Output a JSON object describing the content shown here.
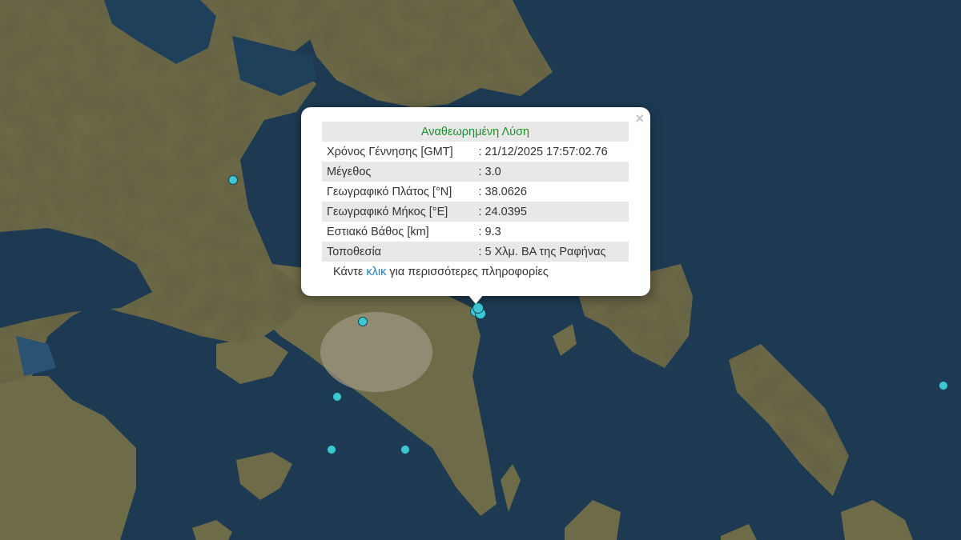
{
  "popup": {
    "title": "Αναθεωρημένη Λύση",
    "close": "×",
    "rows": [
      {
        "label": "Χρόνος Γέννησης [GMT]",
        "value": ": 21/12/2025 17:57:02.76"
      },
      {
        "label": "Μέγεθος",
        "value": ": 3.0"
      },
      {
        "label": "Γεωγραφικό Πλάτος [°N]",
        "value": ": 38.0626"
      },
      {
        "label": "Γεωγραφικό Μήκος [°E]",
        "value": ": 24.0395"
      },
      {
        "label": "Εστιακό Βάθος [km]",
        "value": ": 9.3"
      },
      {
        "label": "Τοποθεσία",
        "value": ": 5 Χλμ. ΒΑ της Ραφήνας"
      }
    ],
    "more_prefix": "Κάντε",
    "more_link": "κλικ",
    "more_suffix": "για περισσότερες πληροφορίες"
  },
  "colors": {
    "sea": "#1d3a52",
    "land": "#6b6a47",
    "marker": "#3fc7d3",
    "title_green": "#1e8f2e",
    "link_blue": "#1c7fc1"
  },
  "map": {
    "marker_icon": "earthquake-epicenter-circle"
  }
}
